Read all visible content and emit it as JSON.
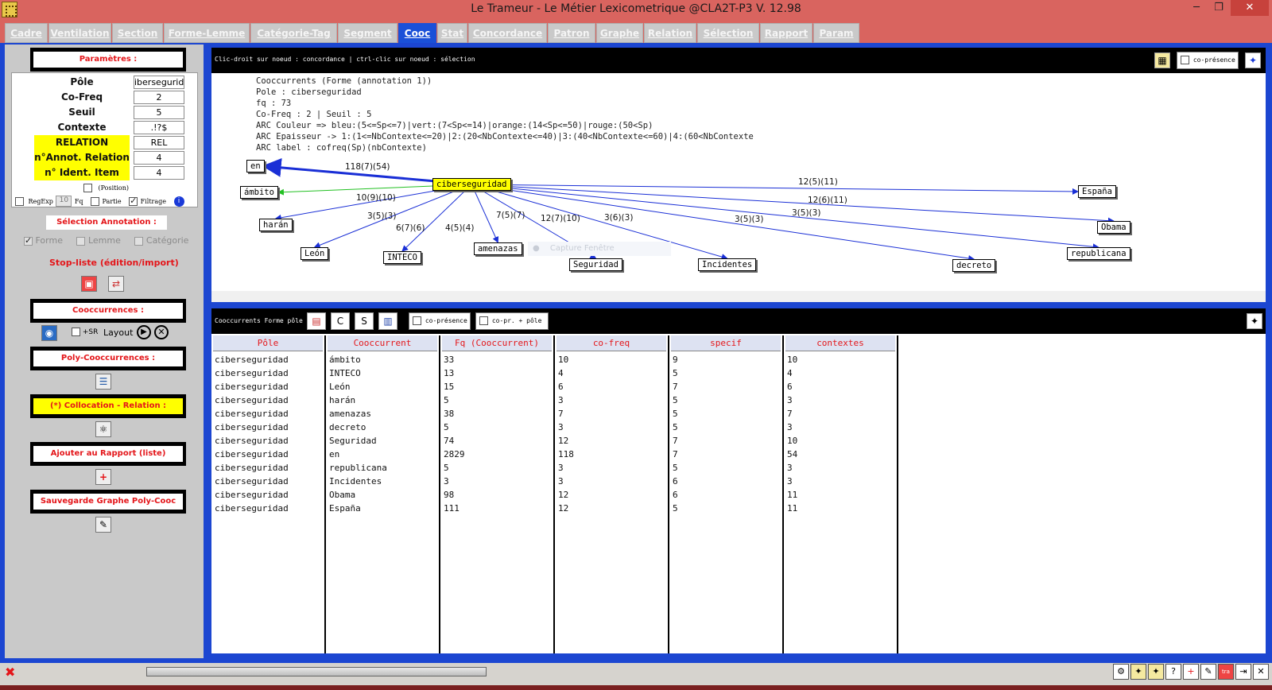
{
  "window": {
    "title": "Le Trameur - Le Métier Lexicometrique @CLA2T-P3 V. 12.98",
    "minimize": "─",
    "maximize": "❐",
    "close": "✕"
  },
  "tabs": [
    {
      "label": "Cadre",
      "active": false
    },
    {
      "label": "Ventilation",
      "active": false
    },
    {
      "label": "Section",
      "active": false
    },
    {
      "label": "Forme-Lemme",
      "active": false
    },
    {
      "label": "Catégorie-Tag",
      "active": false
    },
    {
      "label": "Segment",
      "active": false
    },
    {
      "label": "Cooc",
      "active": true
    },
    {
      "label": "Stat",
      "active": false
    },
    {
      "label": "Concordance",
      "active": false
    },
    {
      "label": "Patron",
      "active": false
    },
    {
      "label": "Graphe",
      "active": false
    },
    {
      "label": "Relation",
      "active": false
    },
    {
      "label": "Sélection",
      "active": false
    },
    {
      "label": "Rapport",
      "active": false
    },
    {
      "label": "Param",
      "active": false
    }
  ],
  "left": {
    "params_title": "Paramètres :",
    "params": [
      {
        "label": "Pôle",
        "value": "iberseguridad",
        "highlight": false
      },
      {
        "label": "Co-Freq",
        "value": "2",
        "highlight": false
      },
      {
        "label": "Seuil",
        "value": "5",
        "highlight": false
      },
      {
        "label": "Contexte",
        "value": ".!?$",
        "highlight": false
      },
      {
        "label": "RELATION",
        "value": "REL",
        "highlight": true
      },
      {
        "label": "n°Annot. Relation",
        "value": "4",
        "highlight": true
      },
      {
        "label": "n° Ident. Item",
        "value": "4",
        "highlight": true
      }
    ],
    "position_label": "(Position)",
    "regexp_label": "RegExp",
    "fq_value": "10",
    "fq_label": "Fq",
    "partie_label": "Partie",
    "filtrage_label": "Filtrage",
    "selection_annotation": "Sélection Annotation :",
    "annotation_options": [
      "Forme",
      "Lemme",
      "Catégorie"
    ],
    "stopliste": "Stop-liste (édition/import)",
    "cooccurrences_title": "Cooccurrences :",
    "sr_label": "+SR",
    "layout_label": "Layout",
    "poly_title": "Poly-Cooccurrences :",
    "collocation_title": "(*) Collocation - Relation :",
    "rapport_title": "Ajouter au Rapport (liste)",
    "sauvegarde_title": "Sauvegarde Graphe Poly-Cooc"
  },
  "graph": {
    "header_text": "Clic-droit sur noeud : concordance | ctrl-clic sur noeud : sélection",
    "copresence_label": "co-présence",
    "info_lines": [
      "Cooccurrents (Forme (annotation 1))",
      "Pole : ciberseguridad",
      "fq : 73",
      "Co-Freq : 2 | Seuil : 5",
      "ARC Couleur => bleu:(5<=Sp<=7)|vert:(7<Sp<=14)|orange:(14<Sp<=50)|rouge:(50<Sp)",
      "ARC Epaisseur -> 1:(1<=NbContexte<=20)|2:(20<NbContexte<=40)|3:(40<NbContexte<=60)|4:(60<NbContexte",
      "ARC label : cofreq(Sp)(nbContexte)"
    ],
    "pole": "ciberseguridad",
    "nodes": [
      {
        "id": "en",
        "label": "en"
      },
      {
        "id": "ambito",
        "label": "ámbito"
      },
      {
        "id": "haran",
        "label": "harán"
      },
      {
        "id": "leon",
        "label": "León"
      },
      {
        "id": "inteco",
        "label": "INTECO"
      },
      {
        "id": "amenazas",
        "label": "amenazas"
      },
      {
        "id": "seguridad",
        "label": "Seguridad"
      },
      {
        "id": "incidentes",
        "label": "Incidentes"
      },
      {
        "id": "decreto",
        "label": "decreto"
      },
      {
        "id": "republicana",
        "label": "republicana"
      },
      {
        "id": "obama",
        "label": "Obama"
      },
      {
        "id": "espana",
        "label": "España"
      }
    ],
    "edges": [
      {
        "to": "en",
        "label": "118(7)(54)",
        "color": "#1a2fd6",
        "width": 3
      },
      {
        "to": "ambito",
        "label": "10(9)(10)",
        "color": "#22c022",
        "width": 1
      },
      {
        "to": "haran",
        "label": "3(5)(3)",
        "color": "#1a2fd6",
        "width": 1
      },
      {
        "to": "leon",
        "label": "6(7)(6)",
        "color": "#1a2fd6",
        "width": 1
      },
      {
        "to": "inteco",
        "label": "4(5)(4)",
        "color": "#1a2fd6",
        "width": 1
      },
      {
        "to": "amenazas",
        "label": "7(5)(7)",
        "color": "#1a2fd6",
        "width": 1
      },
      {
        "to": "seguridad",
        "label": "12(7)(10)",
        "color": "#1a2fd6",
        "width": 1
      },
      {
        "to": "incidentes",
        "label": "3(6)(3)",
        "color": "#1a2fd6",
        "width": 1
      },
      {
        "to": "decreto",
        "label": "3(5)(3)",
        "color": "#1a2fd6",
        "width": 1
      },
      {
        "to": "republicana",
        "label": "3(5)(3)",
        "color": "#1a2fd6",
        "width": 1
      },
      {
        "to": "obama",
        "label": "12(6)(11)",
        "color": "#1a2fd6",
        "width": 1
      },
      {
        "to": "espana",
        "label": "12(5)(11)",
        "color": "#1a2fd6",
        "width": 1
      }
    ],
    "ghost_text": "Capture Fenêtre"
  },
  "table": {
    "header_text": "Cooccurrents Forme pôle",
    "copresence_label": "co-présence",
    "copr_pole_label": "co-pr. + pôle",
    "columns": [
      "Pôle",
      "Cooccurrent",
      "Fq (Cooccurrent)",
      "co-freq",
      "specif",
      "contextes"
    ],
    "rows": [
      [
        "ciberseguridad",
        "ámbito",
        "33",
        "10",
        "9",
        "10"
      ],
      [
        "ciberseguridad",
        "INTECO",
        "13",
        "4",
        "5",
        "4"
      ],
      [
        "ciberseguridad",
        "León",
        "15",
        "6",
        "7",
        "6"
      ],
      [
        "ciberseguridad",
        "harán",
        "5",
        "3",
        "5",
        "3"
      ],
      [
        "ciberseguridad",
        "amenazas",
        "38",
        "7",
        "5",
        "7"
      ],
      [
        "ciberseguridad",
        "decreto",
        "5",
        "3",
        "5",
        "3"
      ],
      [
        "ciberseguridad",
        "Seguridad",
        "74",
        "12",
        "7",
        "10"
      ],
      [
        "ciberseguridad",
        "en",
        "2829",
        "118",
        "7",
        "54"
      ],
      [
        "ciberseguridad",
        "republicana",
        "5",
        "3",
        "5",
        "3"
      ],
      [
        "ciberseguridad",
        "Incidentes",
        "3",
        "3",
        "6",
        "3"
      ],
      [
        "ciberseguridad",
        "Obama",
        "98",
        "12",
        "6",
        "11"
      ],
      [
        "ciberseguridad",
        "España",
        "111",
        "12",
        "5",
        "11"
      ]
    ]
  },
  "colors": {
    "title_bar": "#d9645f",
    "active_tab": "#1a50d8",
    "frame_blue": "#1c46d1",
    "label_red": "#e4161a",
    "highlight_yellow": "#ffff00"
  }
}
